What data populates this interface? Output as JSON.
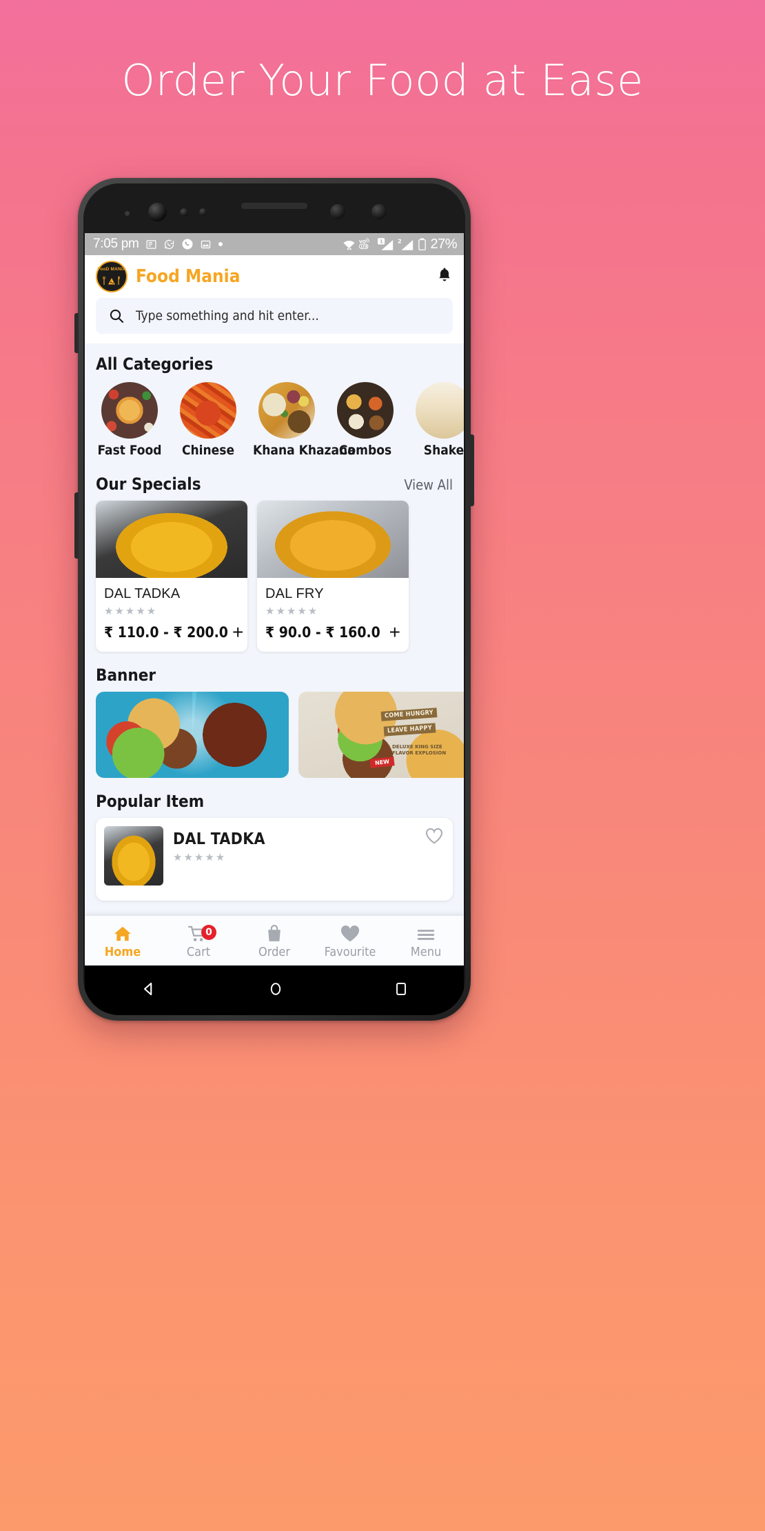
{
  "headline": "Order Your Food at Ease",
  "status_bar": {
    "time": "7:05 pm",
    "battery_percent": "27%",
    "icons": [
      "news-icon",
      "whatsapp-icon",
      "phone-call-icon",
      "gallery-icon",
      "dot-icon"
    ],
    "right_icons": [
      "wifi-icon",
      "volte-icon",
      "signal-sim1-icon",
      "signal-sim2-icon",
      "battery-icon"
    ],
    "sim1_label": "1",
    "sim2_label": "2"
  },
  "appbar": {
    "logo_text": "FooD MANIA",
    "title": "Food Mania",
    "notification_icon": "bell-icon"
  },
  "search": {
    "placeholder": "Type something and hit enter...",
    "icon": "search-icon"
  },
  "sections": {
    "categories_title": "All Categories",
    "specials_title": "Our Specials",
    "specials_view_all": "View All",
    "banner_title": "Banner",
    "popular_title": "Popular Item"
  },
  "categories": [
    {
      "label": "Fast Food",
      "art": "img-pizza"
    },
    {
      "label": "Chinese",
      "art": "img-chinese"
    },
    {
      "label": "Khana Khazana",
      "art": "img-khana"
    },
    {
      "label": "Combos",
      "art": "img-combos"
    },
    {
      "label": "Shake",
      "art": "img-shake"
    }
  ],
  "specials": [
    {
      "name": "DAL TADKA",
      "stars": "★★★★★",
      "price": "₹ 110.0 - ₹ 200.0",
      "add_label": "+",
      "art": "img-dal"
    },
    {
      "name": "DAL FRY",
      "stars": "★★★★★",
      "price": "₹ 90.0 - ₹ 160.0",
      "add_label": "+",
      "art": "img-dalfry"
    }
  ],
  "banners": [
    {
      "art": "img-banner1",
      "alt_name": "burger-cola-splash-banner"
    },
    {
      "art": "img-banner2",
      "alt_name": "come-hungry-leave-happy-banner",
      "line1": "COME HUNGRY",
      "line2": "LEAVE HAPPY",
      "sub": "DELUXE KING SIZE\nFLAVOR EXPLOSION",
      "badge": "NEW"
    }
  ],
  "popular_items": [
    {
      "name": "DAL TADKA",
      "stars": "★★★★★",
      "art": "img-dal",
      "favourite_icon": "heart-outline-icon"
    }
  ],
  "bottom_nav": [
    {
      "label": "Home",
      "icon": "home-icon",
      "active": true
    },
    {
      "label": "Cart",
      "icon": "cart-icon",
      "badge": "0",
      "active": false
    },
    {
      "label": "Order",
      "icon": "bag-icon",
      "active": false
    },
    {
      "label": "Favourite",
      "icon": "heart-icon",
      "active": false
    },
    {
      "label": "Menu",
      "icon": "hamburger-icon",
      "active": false
    }
  ],
  "android_nav": [
    {
      "name": "back-button",
      "icon": "triangle-left-icon"
    },
    {
      "name": "home-button",
      "icon": "circle-icon"
    },
    {
      "name": "recents-button",
      "icon": "square-icon"
    }
  ],
  "colors": {
    "brand": "#f5a623",
    "badge": "#e5212b",
    "screen_bg": "#f2f5fb",
    "bg_top": "#f2709c",
    "bg_bottom": "#fc9a6b"
  }
}
